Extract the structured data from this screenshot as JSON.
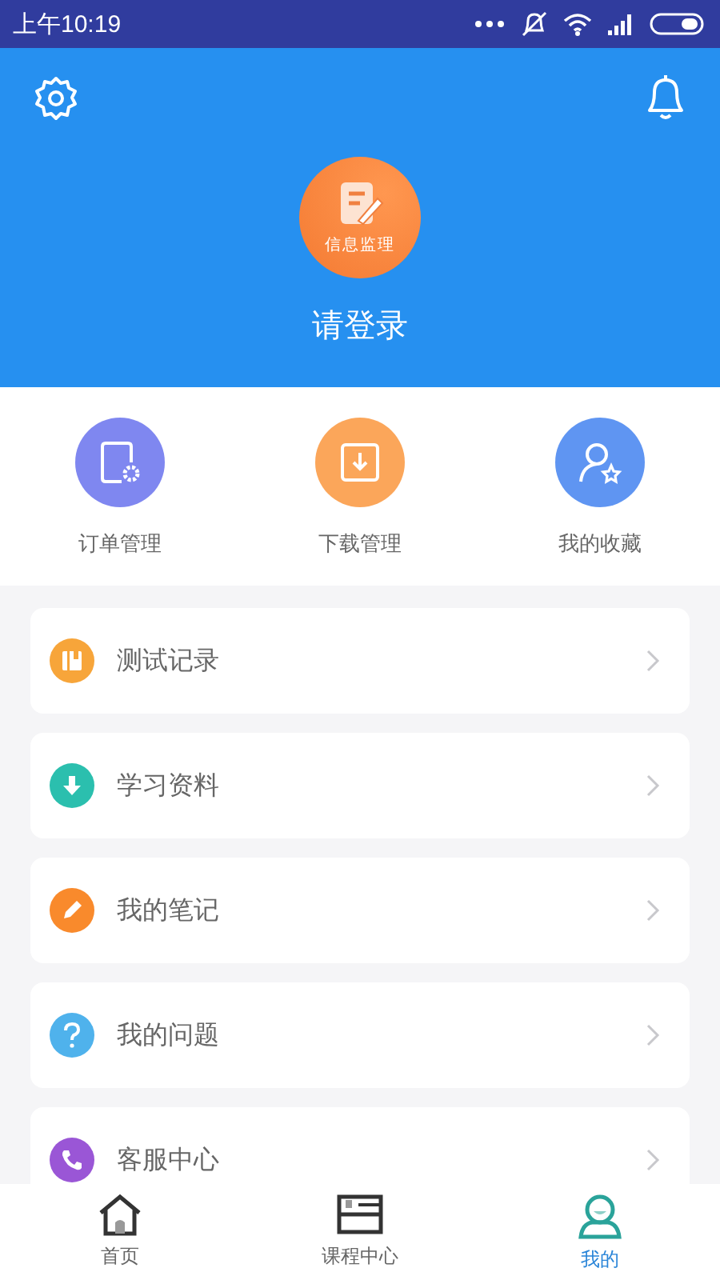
{
  "status_bar": {
    "time": "上午10:19"
  },
  "header": {
    "logo_text": "信息监理",
    "login": "请登录"
  },
  "quick_actions": [
    {
      "label": "订单管理",
      "kind": "order",
      "color": "#7f87f0"
    },
    {
      "label": "下载管理",
      "kind": "download",
      "color": "#fba65a"
    },
    {
      "label": "我的收藏",
      "kind": "favorite",
      "color": "#5f95f2"
    }
  ],
  "menu": [
    {
      "label": "测试记录",
      "kind": "book",
      "color": "#f7a53a"
    },
    {
      "label": "学习资料",
      "kind": "download",
      "color": "#2bbfae"
    },
    {
      "label": "我的笔记",
      "kind": "pencil",
      "color": "#f98a2c"
    },
    {
      "label": "我的问题",
      "kind": "question",
      "color": "#4fb2ec"
    },
    {
      "label": "客服中心",
      "kind": "phone",
      "color": "#9a56d6"
    }
  ],
  "tabs": [
    {
      "label": "首页",
      "kind": "home",
      "selected": false
    },
    {
      "label": "课程中心",
      "kind": "course",
      "selected": false
    },
    {
      "label": "我的",
      "kind": "me",
      "selected": true
    }
  ]
}
